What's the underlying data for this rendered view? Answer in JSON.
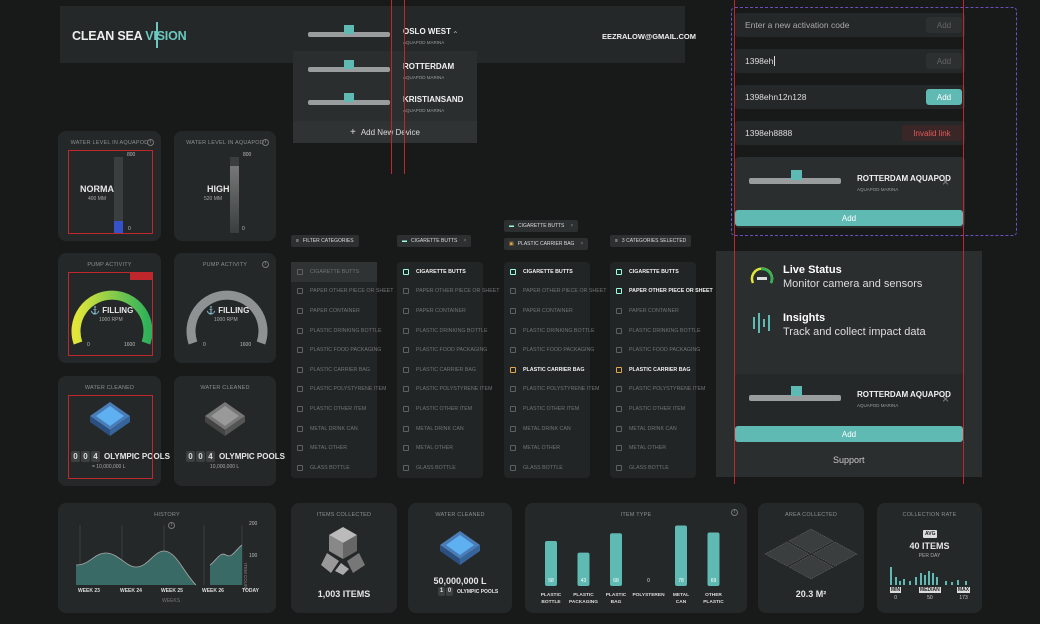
{
  "header": {
    "brand_a": "CLEAN SEA",
    "brand_b": "VISION",
    "email": "EEZRALOW@GMAIL.COM"
  },
  "devices": [
    {
      "name": "OSLO WEST",
      "sub": "AQUAPOD MARINA"
    },
    {
      "name": "ROTTERDAM",
      "sub": "AQUAPOD MARINA"
    },
    {
      "name": "KRISTIANSAND",
      "sub": "AQUAPOD MARINA"
    }
  ],
  "add_device_label": "Add New Device",
  "water_level": [
    {
      "title": "WATER LEVEL IN AQUAPOD",
      "status": "NORMAL",
      "value": "400 MM",
      "max": "800",
      "min": "0",
      "fill": 0.08
    },
    {
      "title": "WATER LEVEL IN AQUAPOD",
      "status": "HIGH",
      "value": "520 MM",
      "max": "800",
      "min": "0",
      "fill": 0.65
    }
  ],
  "pump": [
    {
      "title": "PUMP ACTIVITY",
      "state": "FILLING",
      "rpm": "1000 RPM",
      "min": "0",
      "max": "1600",
      "level": 0.62
    },
    {
      "title": "PUMP ACTIVITY",
      "state": "FILLING",
      "rpm": "1000 RPM",
      "min": "0",
      "max": "1600",
      "level": 0.62
    }
  ],
  "cleaned": [
    {
      "title": "WATER CLEANED",
      "digits": [
        "0",
        "0",
        "4"
      ],
      "label": "OLYMPIC POOLS",
      "sub": "= 10,000,000 L"
    },
    {
      "title": "WATER CLEANED",
      "digits": [
        "0",
        "0",
        "4"
      ],
      "label": "OLYMPIC POOLS",
      "sub": "10,000,000 L"
    }
  ],
  "filters": {
    "items": [
      "CIGARETTE BUTTS",
      "PAPER OTHER PIECE OR SHEET",
      "PAPER CONTAINER",
      "PLASTIC DRINKING BOTTLE",
      "PLASTIC FOOD PACKAGING",
      "PLASTIC CARRIER BAG",
      "PLASTIC POLYSTYRENE ITEM",
      "PLASTIC OTHER ITEM",
      "METAL DRINK CAN",
      "METAL OTHER",
      "GLASS BOTTLE"
    ],
    "header0": "FILTER CATEGORIES",
    "chip1": "CIGARETTE BUTTS",
    "chip2a": "CIGARETTE BUTTS",
    "chip2b": "PLASTIC CARRIER BAG",
    "chip3": "3 CATEGORIES SELECTED",
    "x": "×"
  },
  "activation": {
    "placeholder": "Enter a new activation code",
    "rows": [
      {
        "value": "1398eh",
        "btn": "Add",
        "state": "disabled"
      },
      {
        "value": "1398ehn12n128",
        "btn": "Add",
        "state": "active"
      },
      {
        "value": "1398eh8888",
        "btn": "Invalid link",
        "state": "error"
      }
    ],
    "first_btn": "Add"
  },
  "device_card": {
    "name": "ROTTERDAM AQUAPOD",
    "sub": "AQUAPOD MARINA",
    "add": "Add",
    "close": "×"
  },
  "features": [
    {
      "title": "Live Status",
      "desc": "Monitor camera and sensors"
    },
    {
      "title": "Insights",
      "desc": "Track and collect impact data"
    }
  ],
  "support": "Support",
  "history": {
    "title": "HISTORY",
    "weeks": [
      "WEEK 23",
      "WEEK 24",
      "WEEK 25",
      "WEEK 26",
      "TODAY"
    ],
    "xlabel": "WEEKS",
    "ylabel": "ITEM COUNT",
    "ymax": "200",
    "ymid": "100"
  },
  "items_collected": {
    "title": "ITEMS COLLECTED",
    "value": "1,003 ITEMS"
  },
  "water_cleaned_b": {
    "title": "WATER CLEANED",
    "value": "50,000,000 L",
    "digits": [
      "1",
      "0"
    ],
    "label": "OLYMPIC POOLS"
  },
  "item_type": {
    "title": "ITEM TYPE"
  },
  "chart_data": {
    "type": "bar",
    "title": "ITEM TYPE",
    "categories": [
      "PLASTIC BOTTLE",
      "PLASTIC PACKAGING",
      "PLASTIC BAG",
      "POLYSTEREN",
      "METAL CAN",
      "OTHER PLASTIC"
    ],
    "values": [
      58,
      43,
      68,
      0,
      78,
      69
    ]
  },
  "area": {
    "title": "AREA COLLECTED",
    "value": "20.3 M²"
  },
  "rate": {
    "title": "COLLECTION RATE",
    "avg": "AVG",
    "value": "40 ITEMS",
    "per": "PER DAY",
    "min_l": "MIN",
    "min_v": "0",
    "med_l": "MEDIAN",
    "med_v": "50",
    "max_l": "MAX",
    "max_v": "173"
  }
}
